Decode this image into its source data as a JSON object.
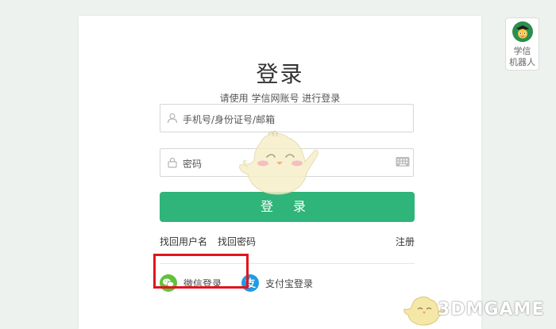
{
  "login": {
    "title": "登录",
    "subtitle": "请使用 学信网账号 进行登录",
    "username_placeholder": "手机号/身份证号/邮箱",
    "password_placeholder": "密码",
    "submit_label": "登 录",
    "find_username": "找回用户名",
    "find_password": "找回密码",
    "register": "注册"
  },
  "third_party": {
    "wechat_label": "微信登录",
    "alipay_label": "支付宝登录"
  },
  "robot": {
    "label_line1": "学信",
    "label_line2": "机器人"
  },
  "watermark": {
    "text": "3DMGAME"
  },
  "colors": {
    "primary_green": "#2fb479",
    "wechat_green": "#5fc33a",
    "alipay_blue": "#1e9be5",
    "highlight_red": "#e0151d",
    "background": "#eef2ef"
  },
  "icons": {
    "username": "user-icon",
    "password": "lock-icon",
    "keyboard": "keyboard-icon",
    "wechat": "wechat-icon",
    "alipay": "alipay-icon",
    "robot": "robot-avatar-icon"
  }
}
